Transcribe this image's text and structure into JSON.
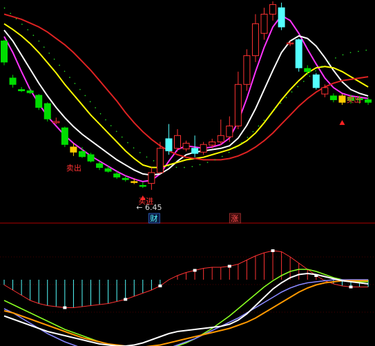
{
  "chart_data": [
    {
      "type": "candlestick",
      "panel": "price",
      "ylim": [
        6.2,
        9.4
      ],
      "colors": {
        "up": "#ff3232",
        "down": "#54ffff",
        "down_alt": "#00dd00",
        "background": "#000000"
      },
      "candles": [
        {
          "o": 8.78,
          "h": 8.8,
          "l": 8.4,
          "c": 8.45,
          "color": "down_alt"
        },
        {
          "o": 8.2,
          "h": 8.25,
          "l": 8.05,
          "c": 8.1,
          "color": "down_alt"
        },
        {
          "o": 8.02,
          "h": 8.06,
          "l": 7.98,
          "c": 8.0,
          "color": "down_alt"
        },
        {
          "o": 8.0,
          "h": 8.04,
          "l": 7.95,
          "c": 7.97,
          "color": "down_alt"
        },
        {
          "o": 7.93,
          "h": 7.95,
          "l": 7.7,
          "c": 7.74,
          "color": "down_alt"
        },
        {
          "o": 7.8,
          "h": 7.82,
          "l": 7.52,
          "c": 7.56,
          "color": "down_alt"
        },
        {
          "o": 7.5,
          "h": 7.58,
          "l": 7.48,
          "c": 7.52,
          "color": "up"
        },
        {
          "o": 7.42,
          "h": 7.44,
          "l": 7.12,
          "c": 7.16,
          "color": "down_alt"
        },
        {
          "o": 7.12,
          "h": 7.18,
          "l": 6.98,
          "c": 7.04,
          "color": "up_yellow"
        },
        {
          "o": 7.05,
          "h": 7.12,
          "l": 6.95,
          "c": 6.97,
          "color": "down_alt"
        },
        {
          "o": 7.0,
          "h": 7.03,
          "l": 6.88,
          "c": 6.9,
          "color": "down_alt"
        },
        {
          "o": 6.86,
          "h": 6.9,
          "l": 6.76,
          "c": 6.8,
          "color": "down_alt"
        },
        {
          "o": 6.78,
          "h": 6.82,
          "l": 6.72,
          "c": 6.74,
          "color": "down_alt"
        },
        {
          "o": 6.7,
          "h": 6.74,
          "l": 6.62,
          "c": 6.65,
          "color": "down_alt"
        },
        {
          "o": 6.63,
          "h": 6.67,
          "l": 6.58,
          "c": 6.61,
          "color": "down_alt"
        },
        {
          "o": 6.58,
          "h": 6.63,
          "l": 6.54,
          "c": 6.57,
          "color": "up_yellow"
        },
        {
          "o": 6.52,
          "h": 6.57,
          "l": 6.48,
          "c": 6.51,
          "color": "down_alt"
        },
        {
          "o": 6.55,
          "h": 6.8,
          "l": 6.45,
          "c": 6.72,
          "color": "up"
        },
        {
          "o": 6.72,
          "h": 7.2,
          "l": 6.7,
          "c": 7.1,
          "color": "up"
        },
        {
          "o": 7.25,
          "h": 7.48,
          "l": 7.0,
          "c": 7.06,
          "color": "down"
        },
        {
          "o": 7.1,
          "h": 7.4,
          "l": 7.05,
          "c": 7.3,
          "color": "up"
        },
        {
          "o": 7.18,
          "h": 7.22,
          "l": 7.05,
          "c": 7.09,
          "color": "up"
        },
        {
          "o": 7.1,
          "h": 7.3,
          "l": 6.96,
          "c": 7.02,
          "color": "down"
        },
        {
          "o": 7.04,
          "h": 7.2,
          "l": 7.0,
          "c": 7.16,
          "color": "up"
        },
        {
          "o": 7.15,
          "h": 7.25,
          "l": 7.1,
          "c": 7.2,
          "color": "up"
        },
        {
          "o": 7.2,
          "h": 7.55,
          "l": 7.15,
          "c": 7.3,
          "color": "up"
        },
        {
          "o": 7.28,
          "h": 7.6,
          "l": 7.2,
          "c": 7.45,
          "color": "up"
        },
        {
          "o": 7.45,
          "h": 8.3,
          "l": 7.4,
          "c": 8.1,
          "color": "up"
        },
        {
          "o": 8.1,
          "h": 8.65,
          "l": 8.0,
          "c": 8.55,
          "color": "up"
        },
        {
          "o": 8.55,
          "h": 9.2,
          "l": 8.45,
          "c": 9.05,
          "color": "up"
        },
        {
          "o": 8.9,
          "h": 9.3,
          "l": 8.8,
          "c": 9.2,
          "color": "up"
        },
        {
          "o": 9.2,
          "h": 9.4,
          "l": 9.1,
          "c": 9.35,
          "color": "up"
        },
        {
          "o": 9.3,
          "h": 9.38,
          "l": 8.95,
          "c": 9.0,
          "color": "down"
        },
        {
          "o": 8.75,
          "h": 8.78,
          "l": 8.7,
          "c": 8.74,
          "color": "up"
        },
        {
          "o": 8.8,
          "h": 8.82,
          "l": 8.3,
          "c": 8.36,
          "color": "down"
        },
        {
          "o": 8.35,
          "h": 8.4,
          "l": 8.25,
          "c": 8.3,
          "color": "down_alt"
        },
        {
          "o": 8.25,
          "h": 8.28,
          "l": 8.02,
          "c": 8.05,
          "color": "down"
        },
        {
          "o": 8.05,
          "h": 8.1,
          "l": 7.9,
          "c": 7.95,
          "color": "up"
        },
        {
          "o": 7.92,
          "h": 7.96,
          "l": 7.82,
          "c": 7.86,
          "color": "down_alt"
        },
        {
          "o": 7.82,
          "h": 7.95,
          "l": 7.78,
          "c": 7.92,
          "color": "up_yellow"
        },
        {
          "o": 7.9,
          "h": 7.94,
          "l": 7.8,
          "c": 7.85,
          "color": "down_alt"
        },
        {
          "o": 7.86,
          "h": 7.92,
          "l": 7.8,
          "c": 7.88,
          "color": "down_alt"
        },
        {
          "o": 7.86,
          "h": 7.9,
          "l": 7.78,
          "c": 7.82,
          "color": "down_alt"
        }
      ],
      "moving_averages": [
        {
          "color": "#ff33ff",
          "values": [
            8.85,
            8.6,
            8.3,
            8.02,
            7.8,
            7.6,
            7.45,
            7.3,
            7.18,
            7.08,
            6.98,
            6.9,
            6.82,
            6.74,
            6.67,
            6.62,
            6.58,
            6.6,
            6.7,
            6.9,
            7.08,
            7.14,
            7.12,
            7.1,
            7.12,
            7.16,
            7.26,
            7.52,
            7.88,
            8.3,
            8.68,
            9.0,
            9.18,
            9.1,
            8.9,
            8.65,
            8.42,
            8.2,
            8.05,
            7.96,
            7.92,
            7.9,
            7.88
          ]
        },
        {
          "color": "#ffffff",
          "values": [
            8.95,
            8.78,
            8.56,
            8.34,
            8.12,
            7.92,
            7.74,
            7.58,
            7.44,
            7.32,
            7.22,
            7.12,
            7.02,
            6.92,
            6.84,
            6.76,
            6.7,
            6.68,
            6.7,
            6.78,
            6.9,
            7.0,
            7.04,
            7.06,
            7.08,
            7.1,
            7.14,
            7.26,
            7.46,
            7.72,
            8.02,
            8.32,
            8.6,
            8.78,
            8.86,
            8.82,
            8.7,
            8.52,
            8.32,
            8.14,
            8.02,
            7.96,
            7.92
          ]
        },
        {
          "color": "#ffff00",
          "values": [
            9.05,
            8.96,
            8.86,
            8.74,
            8.6,
            8.44,
            8.28,
            8.1,
            7.94,
            7.78,
            7.62,
            7.48,
            7.34,
            7.2,
            7.06,
            6.94,
            6.84,
            6.8,
            6.8,
            6.84,
            6.88,
            6.92,
            6.94,
            6.96,
            7.0,
            7.04,
            7.08,
            7.14,
            7.22,
            7.34,
            7.5,
            7.68,
            7.86,
            8.02,
            8.16,
            8.28,
            8.36,
            8.38,
            8.36,
            8.3,
            8.22,
            8.14,
            8.06
          ]
        },
        {
          "color": "#dd2222",
          "values": [
            9.2,
            9.16,
            9.12,
            9.06,
            9.0,
            8.92,
            8.82,
            8.72,
            8.6,
            8.46,
            8.32,
            8.16,
            8.0,
            7.84,
            7.66,
            7.5,
            7.36,
            7.24,
            7.14,
            7.06,
            7.0,
            6.96,
            6.94,
            6.92,
            6.92,
            6.92,
            6.94,
            6.98,
            7.04,
            7.12,
            7.22,
            7.34,
            7.48,
            7.62,
            7.76,
            7.88,
            7.98,
            8.06,
            8.12,
            8.16,
            8.18,
            8.2,
            8.22
          ]
        },
        {
          "color": "#22dd22",
          "style": "dotted",
          "values": [
            9.3,
            9.18,
            9.05,
            8.92,
            8.78,
            8.62,
            8.46,
            8.3,
            8.14,
            7.98,
            7.82,
            7.66,
            7.5,
            7.36,
            7.22,
            7.1,
            7.0,
            6.92,
            6.86,
            6.82,
            6.8,
            6.8,
            6.82,
            6.86,
            6.9,
            6.96,
            7.04,
            7.14,
            7.26,
            7.4,
            7.54,
            7.68,
            7.82,
            7.96,
            8.08,
            8.2,
            8.32,
            8.42,
            8.5,
            8.56,
            8.6,
            8.62,
            8.64
          ]
        }
      ],
      "annotations": [
        {
          "text": "← 6.45",
          "kind": "low_label"
        },
        {
          "text": "卖出",
          "kind": "signal"
        },
        {
          "text": "买进",
          "kind": "signal"
        },
        {
          "text": "卖出",
          "kind": "signal"
        }
      ],
      "badges": [
        {
          "text": "财",
          "color": "#54ffff"
        },
        {
          "text": "涨",
          "color": "#ff5050"
        }
      ]
    },
    {
      "type": "macd",
      "panel": "indicator",
      "ylim": [
        -0.62,
        0.5
      ],
      "histogram": [
        -0.05,
        -0.1,
        -0.15,
        -0.2,
        -0.23,
        -0.25,
        -0.26,
        -0.27,
        -0.27,
        -0.26,
        -0.25,
        -0.24,
        -0.23,
        -0.21,
        -0.19,
        -0.16,
        -0.13,
        -0.1,
        -0.06,
        0.0,
        0.04,
        0.07,
        0.09,
        0.11,
        0.12,
        0.12,
        0.13,
        0.15,
        0.19,
        0.23,
        0.26,
        0.28,
        0.27,
        0.22,
        0.16,
        0.1,
        0.04,
        -0.01,
        -0.04,
        -0.06,
        -0.07,
        -0.07,
        -0.07
      ],
      "dif": {
        "color": "#ffffff",
        "values": [
          -0.35,
          -0.38,
          -0.41,
          -0.44,
          -0.47,
          -0.5,
          -0.52,
          -0.54,
          -0.56,
          -0.58,
          -0.6,
          -0.62,
          -0.63,
          -0.64,
          -0.64,
          -0.63,
          -0.61,
          -0.58,
          -0.55,
          -0.52,
          -0.5,
          -0.49,
          -0.48,
          -0.47,
          -0.46,
          -0.45,
          -0.43,
          -0.39,
          -0.33,
          -0.25,
          -0.17,
          -0.09,
          -0.03,
          0.02,
          0.05,
          0.06,
          0.05,
          0.03,
          0.01,
          -0.01,
          -0.02,
          -0.03,
          -0.04
        ]
      },
      "dea": {
        "color": "#ff9900",
        "values": [
          -0.3,
          -0.32,
          -0.35,
          -0.38,
          -0.41,
          -0.44,
          -0.47,
          -0.5,
          -0.53,
          -0.56,
          -0.58,
          -0.6,
          -0.62,
          -0.63,
          -0.64,
          -0.65,
          -0.65,
          -0.64,
          -0.63,
          -0.61,
          -0.59,
          -0.57,
          -0.55,
          -0.53,
          -0.51,
          -0.49,
          -0.47,
          -0.44,
          -0.41,
          -0.37,
          -0.32,
          -0.27,
          -0.22,
          -0.17,
          -0.12,
          -0.08,
          -0.05,
          -0.03,
          -0.02,
          -0.01,
          -0.01,
          -0.01,
          -0.01
        ]
      },
      "extra_lines": [
        {
          "color": "#88ff22",
          "values": [
            -0.2,
            -0.24,
            -0.28,
            -0.32,
            -0.36,
            -0.4,
            -0.44,
            -0.48,
            -0.51,
            -0.54,
            -0.57,
            -0.6,
            -0.62,
            -0.64,
            -0.66,
            -0.67,
            -0.68,
            -0.68,
            -0.67,
            -0.66,
            -0.64,
            -0.61,
            -0.57,
            -0.52,
            -0.47,
            -0.41,
            -0.35,
            -0.28,
            -0.21,
            -0.14,
            -0.07,
            -0.01,
            0.04,
            0.08,
            0.1,
            0.1,
            0.08,
            0.05,
            0.02,
            0.0,
            -0.01,
            -0.02,
            -0.02
          ]
        },
        {
          "color": "#8888ff",
          "values": [
            -0.28,
            -0.32,
            -0.37,
            -0.42,
            -0.47,
            -0.52,
            -0.56,
            -0.6,
            -0.63,
            -0.66,
            -0.68,
            -0.7,
            -0.71,
            -0.72,
            -0.72,
            -0.72,
            -0.71,
            -0.7,
            -0.68,
            -0.66,
            -0.63,
            -0.6,
            -0.57,
            -0.53,
            -0.49,
            -0.45,
            -0.41,
            -0.37,
            -0.32,
            -0.27,
            -0.22,
            -0.17,
            -0.12,
            -0.08,
            -0.05,
            -0.03,
            -0.02,
            -0.01,
            0.0,
            0.0,
            0.0,
            0.0,
            0.0
          ]
        }
      ],
      "trend_line": {
        "color": "#ff3333"
      }
    }
  ]
}
